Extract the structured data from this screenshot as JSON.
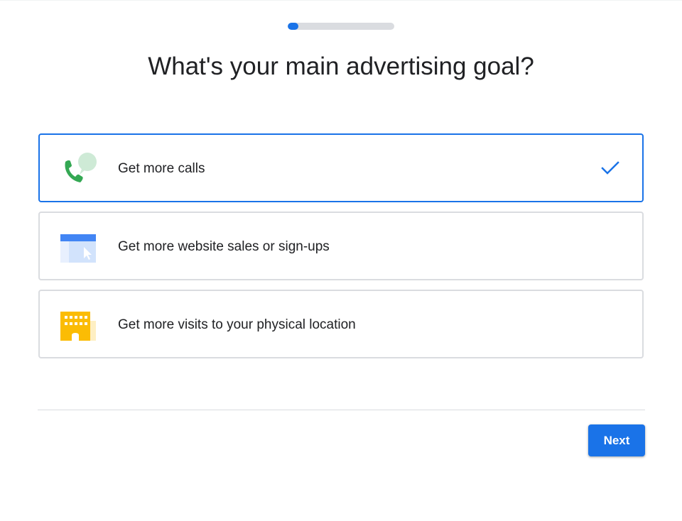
{
  "progress": {
    "fraction": 0.1,
    "track_color": "#dadce0",
    "fill_color": "#1a73e8"
  },
  "title": "What's your main advertising goal?",
  "options": [
    {
      "label": "Get more calls",
      "icon": "phone-call-icon",
      "selected": true
    },
    {
      "label": "Get more website sales or sign-ups",
      "icon": "website-cursor-icon",
      "selected": false
    },
    {
      "label": "Get more visits to your physical location",
      "icon": "building-icon",
      "selected": false
    }
  ],
  "selected_indicator_icon": "checkmark-icon",
  "actions": {
    "next_label": "Next"
  },
  "colors": {
    "accent": "#1a73e8",
    "border": "#dadce0",
    "text": "#202124"
  }
}
